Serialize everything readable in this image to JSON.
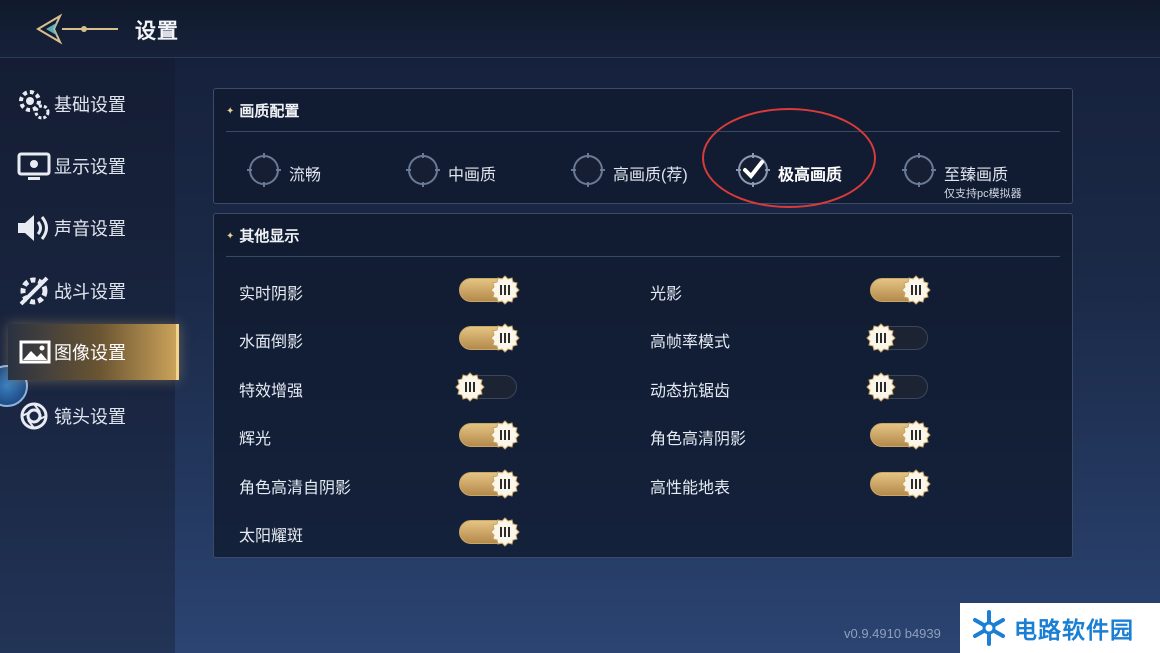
{
  "header": {
    "title": "设置"
  },
  "sidebar": {
    "items": [
      {
        "label": "基础设置",
        "icon": "gears-icon",
        "active": false
      },
      {
        "label": "显示设置",
        "icon": "monitor-icon",
        "active": false
      },
      {
        "label": "声音设置",
        "icon": "speaker-icon",
        "active": false
      },
      {
        "label": "战斗设置",
        "icon": "battle-icon",
        "active": false
      },
      {
        "label": "图像设置",
        "icon": "image-icon",
        "active": true
      },
      {
        "label": "镜头设置",
        "icon": "camera-lens-icon",
        "active": false
      }
    ]
  },
  "quality": {
    "title": "画质配置",
    "options": [
      {
        "label": "流畅",
        "selected": false
      },
      {
        "label": "中画质",
        "selected": false
      },
      {
        "label": "高画质(荐)",
        "selected": false
      },
      {
        "label": "极高画质",
        "selected": true
      },
      {
        "label": "至臻画质",
        "selected": false,
        "note": "仅支持pc模拟器"
      }
    ]
  },
  "other": {
    "title": "其他显示",
    "toggles": [
      {
        "label": "实时阴影",
        "on": true
      },
      {
        "label": "光影",
        "on": true
      },
      {
        "label": "水面倒影",
        "on": true
      },
      {
        "label": "高帧率模式",
        "on": false
      },
      {
        "label": "特效增强",
        "on": false
      },
      {
        "label": "动态抗锯齿",
        "on": false
      },
      {
        "label": "辉光",
        "on": true
      },
      {
        "label": "角色高清阴影",
        "on": true
      },
      {
        "label": "角色高清自阴影",
        "on": true
      },
      {
        "label": "高性能地表",
        "on": true
      },
      {
        "label": "太阳耀斑",
        "on": true
      }
    ]
  },
  "footer": {
    "version": "v0.9.4910 b4939"
  },
  "watermark": {
    "text": "电路软件园"
  },
  "colors": {
    "accent_gold": "#d9b46e",
    "annotation_red": "#d93a3a"
  }
}
